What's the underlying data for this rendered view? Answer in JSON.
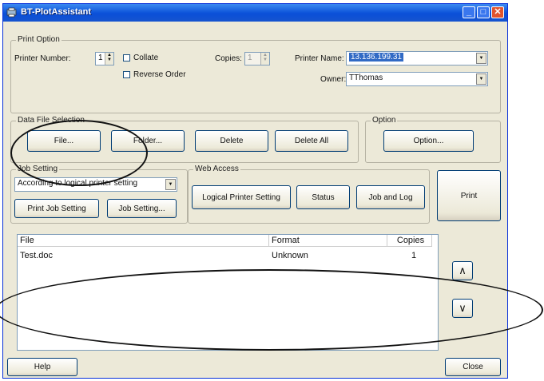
{
  "window": {
    "title": "BT-PlotAssistant",
    "icon": "app-icon",
    "controls": {
      "minimize": "_",
      "maximize": "□",
      "close": "✕"
    }
  },
  "print_option": {
    "legend": "Print Option",
    "printer_number_label": "Printer Number:",
    "printer_number_value": "1",
    "collate_label": "Collate",
    "reverse_order_label": "Reverse Order",
    "copies_label": "Copies:",
    "copies_value": "1",
    "printer_name_label": "Printer Name:",
    "printer_name_value": "13.136.199.31",
    "owner_label": "Owner:",
    "owner_value": "TThomas"
  },
  "data_file_selection": {
    "legend": "Data File Selection",
    "file_button": "File...",
    "folder_button": "Folder...",
    "delete_button": "Delete",
    "delete_all_button": "Delete All"
  },
  "option_group": {
    "legend": "Option",
    "option_button": "Option..."
  },
  "job_setting": {
    "legend": "Job Setting",
    "select_value": "According to logical printer setting",
    "print_job_setting_button": "Print Job Setting",
    "job_setting_button": "Job Setting..."
  },
  "web_access": {
    "legend": "Web Access",
    "logical_printer_setting_button": "Logical Printer Setting",
    "status_button": "Status",
    "job_and_log_button": "Job and Log"
  },
  "print_button": "Print",
  "file_list": {
    "columns": [
      "File",
      "Format",
      "Copies"
    ],
    "rows": [
      {
        "file": "Test.doc",
        "format": "Unknown",
        "copies": "1"
      }
    ]
  },
  "move_up_button": "∧",
  "move_down_button": "∨",
  "help_button": "Help",
  "close_button": "Close",
  "colors": {
    "titlebar": "#0a4fd8",
    "dialog_bg": "#ece9d8",
    "selection": "#316ac5"
  }
}
